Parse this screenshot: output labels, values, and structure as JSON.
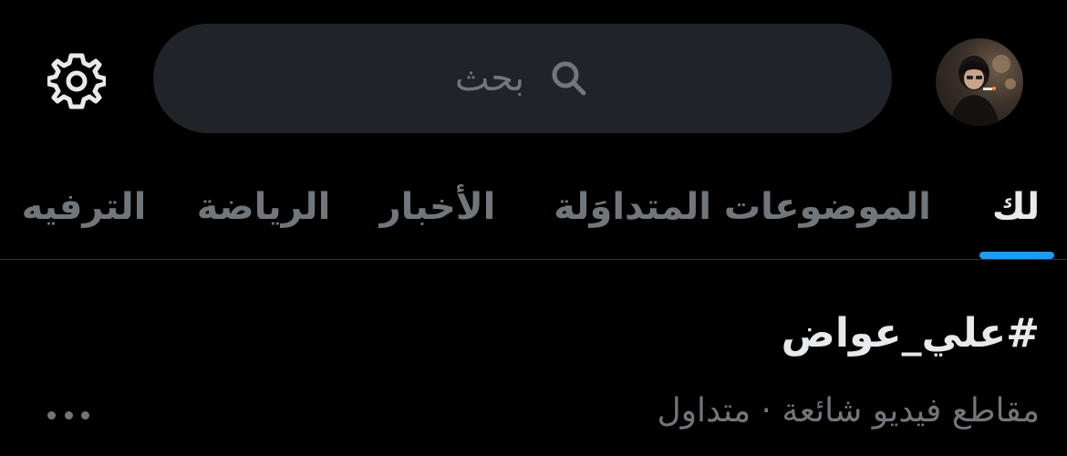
{
  "header": {
    "avatar_icon": "profile-avatar",
    "search": {
      "placeholder": "بحث",
      "icon": "search-icon"
    },
    "settings_icon": "gear-icon"
  },
  "tabs": [
    {
      "label": "لك",
      "active": true
    },
    {
      "label": "الموضوعات المتداوَلة",
      "active": false
    },
    {
      "label": "الأخبار",
      "active": false
    },
    {
      "label": "الرياضة",
      "active": false
    },
    {
      "label": "الترفيه",
      "active": false
    }
  ],
  "trend": {
    "title": "#علي_عواض",
    "meta": "مقاطع فيديو شائعة · متداول",
    "more_icon": "more-horizontal-icon"
  },
  "colors": {
    "background": "#000000",
    "search_bg": "#202327",
    "primary_text": "#e7e9ea",
    "secondary_text": "#71767b",
    "accent": "#1d9bf0",
    "divider": "#2f3336"
  }
}
